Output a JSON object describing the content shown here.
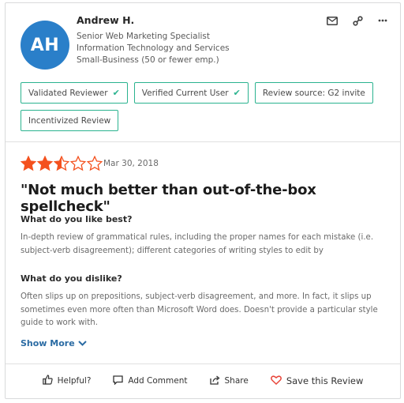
{
  "reviewer": {
    "initials": "AH",
    "avatar_color": "#2a7fc9",
    "name": "Andrew H.",
    "job_title": "Senior Web Marketing Specialist",
    "industry": "Information Technology and Services",
    "company_size": "Small-Business (50 or fewer emp.)"
  },
  "top_icons": [
    "mail-icon",
    "link-icon",
    "more-icon"
  ],
  "badges": [
    {
      "label": "Validated Reviewer",
      "check": true
    },
    {
      "label": "Verified Current User",
      "check": true
    },
    {
      "label": "Review source: G2 invite",
      "check": false
    },
    {
      "label": "Incentivized Review",
      "check": false
    }
  ],
  "review": {
    "rating": 2.5,
    "max_rating": 5,
    "star_color": "#f4511e",
    "date": "Mar 30, 2018",
    "title": "\"Not much better than out-of-the-box spellcheck\"",
    "likes_question": "What do you like best?",
    "likes_answer": "In-depth review of grammatical rules, including the proper names for each mistake (i.e. subject-verb disagreement); different categories of writing styles to edit by",
    "dislikes_question": "What do you dislike?",
    "dislikes_answer": "Often slips up on prepositions, subject-verb disagreement, and more. In fact, it slips up sometimes even more often than Microsoft Word does. Doesn't provide a particular style guide to work with.",
    "show_more": "Show More"
  },
  "actions": {
    "helpful": "Helpful?",
    "comment": "Add Comment",
    "share": "Share",
    "save": "Save this Review"
  },
  "accent_colors": {
    "badge_border": "#2bb38f",
    "link": "#2a6ba3",
    "heart": "#e8463b"
  }
}
